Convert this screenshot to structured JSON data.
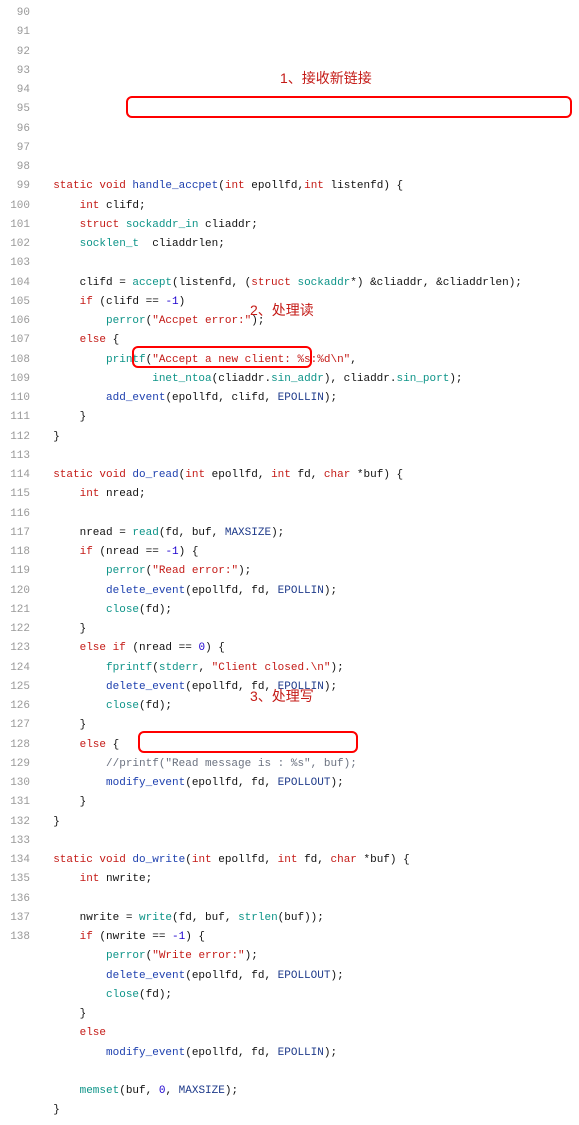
{
  "annotations": {
    "a1": "1、接收新链接",
    "a2": "2、处理读",
    "a3": "3、处理写"
  },
  "lines": [
    {
      "n": 90,
      "segs": [
        {
          "t": "  ",
          "c": "ident"
        },
        {
          "t": "static void ",
          "c": "kw-red"
        },
        {
          "t": "handle_accpet",
          "c": "fn-blue"
        },
        {
          "t": "(",
          "c": "op"
        },
        {
          "t": "int",
          "c": "kw-red"
        },
        {
          "t": " epollfd,",
          "c": "ident"
        },
        {
          "t": "int",
          "c": "kw-red"
        },
        {
          "t": " listenfd) {",
          "c": "ident"
        }
      ]
    },
    {
      "n": 91,
      "segs": [
        {
          "t": "      ",
          "c": "ident"
        },
        {
          "t": "int",
          "c": "kw-red"
        },
        {
          "t": " clifd;",
          "c": "ident"
        }
      ]
    },
    {
      "n": 92,
      "segs": [
        {
          "t": "      ",
          "c": "ident"
        },
        {
          "t": "struct",
          "c": "kw-red"
        },
        {
          "t": " ",
          "c": "ident"
        },
        {
          "t": "sockaddr_in",
          "c": "fn-teal"
        },
        {
          "t": " cliaddr;",
          "c": "ident"
        }
      ]
    },
    {
      "n": 93,
      "segs": [
        {
          "t": "      ",
          "c": "ident"
        },
        {
          "t": "socklen_t",
          "c": "fn-teal"
        },
        {
          "t": "  cliaddrlen;",
          "c": "ident"
        }
      ]
    },
    {
      "n": 94,
      "segs": [
        {
          "t": " ",
          "c": "ident"
        }
      ]
    },
    {
      "n": 95,
      "segs": [
        {
          "t": "      clifd = ",
          "c": "ident"
        },
        {
          "t": "accept",
          "c": "fn-teal"
        },
        {
          "t": "(listenfd, (",
          "c": "ident"
        },
        {
          "t": "struct",
          "c": "kw-red"
        },
        {
          "t": " ",
          "c": "ident"
        },
        {
          "t": "sockaddr",
          "c": "fn-teal"
        },
        {
          "t": "*) &cliaddr, &cliaddrlen);",
          "c": "ident"
        }
      ]
    },
    {
      "n": 96,
      "segs": [
        {
          "t": "      ",
          "c": "ident"
        },
        {
          "t": "if",
          "c": "kw-red"
        },
        {
          "t": " (clifd == ",
          "c": "ident"
        },
        {
          "t": "-1",
          "c": "num"
        },
        {
          "t": ")",
          "c": "ident"
        }
      ]
    },
    {
      "n": 97,
      "segs": [
        {
          "t": "          ",
          "c": "ident"
        },
        {
          "t": "perror",
          "c": "fn-teal"
        },
        {
          "t": "(",
          "c": "ident"
        },
        {
          "t": "\"Accpet error:\"",
          "c": "str"
        },
        {
          "t": ");",
          "c": "ident"
        }
      ]
    },
    {
      "n": 98,
      "segs": [
        {
          "t": "      ",
          "c": "ident"
        },
        {
          "t": "else",
          "c": "kw-red"
        },
        {
          "t": " {",
          "c": "ident"
        }
      ]
    },
    {
      "n": 99,
      "segs": [
        {
          "t": "          ",
          "c": "ident"
        },
        {
          "t": "printf",
          "c": "fn-teal"
        },
        {
          "t": "(",
          "c": "ident"
        },
        {
          "t": "\"Accept a new client: %s:%d\\n\"",
          "c": "str"
        },
        {
          "t": ",",
          "c": "ident"
        }
      ]
    },
    {
      "n": 100,
      "segs": [
        {
          "t": "                 ",
          "c": "ident"
        },
        {
          "t": "inet_ntoa",
          "c": "fn-teal"
        },
        {
          "t": "(cliaddr.",
          "c": "ident"
        },
        {
          "t": "sin_addr",
          "c": "fn-teal"
        },
        {
          "t": "), cliaddr.",
          "c": "ident"
        },
        {
          "t": "sin_port",
          "c": "fn-teal"
        },
        {
          "t": ");",
          "c": "ident"
        }
      ]
    },
    {
      "n": 101,
      "segs": [
        {
          "t": "          ",
          "c": "ident"
        },
        {
          "t": "add_event",
          "c": "fn-blue"
        },
        {
          "t": "(epollfd, clifd, ",
          "c": "ident"
        },
        {
          "t": "EPOLLIN",
          "c": "const-blue"
        },
        {
          "t": ");",
          "c": "ident"
        }
      ]
    },
    {
      "n": 102,
      "segs": [
        {
          "t": "      }",
          "c": "ident"
        }
      ]
    },
    {
      "n": 103,
      "segs": [
        {
          "t": "  }",
          "c": "ident"
        }
      ]
    },
    {
      "n": 104,
      "segs": [
        {
          "t": " ",
          "c": "ident"
        }
      ]
    },
    {
      "n": 105,
      "segs": [
        {
          "t": "  ",
          "c": "ident"
        },
        {
          "t": "static void ",
          "c": "kw-red"
        },
        {
          "t": "do_read",
          "c": "fn-blue"
        },
        {
          "t": "(",
          "c": "ident"
        },
        {
          "t": "int",
          "c": "kw-red"
        },
        {
          "t": " epollfd, ",
          "c": "ident"
        },
        {
          "t": "int",
          "c": "kw-red"
        },
        {
          "t": " fd, ",
          "c": "ident"
        },
        {
          "t": "char",
          "c": "kw-red"
        },
        {
          "t": " *buf) {",
          "c": "ident"
        }
      ]
    },
    {
      "n": 106,
      "segs": [
        {
          "t": "      ",
          "c": "ident"
        },
        {
          "t": "int",
          "c": "kw-red"
        },
        {
          "t": " nread;",
          "c": "ident"
        }
      ]
    },
    {
      "n": 107,
      "segs": [
        {
          "t": " ",
          "c": "ident"
        }
      ]
    },
    {
      "n": 108,
      "segs": [
        {
          "t": "      nread = ",
          "c": "ident"
        },
        {
          "t": "read",
          "c": "fn-teal"
        },
        {
          "t": "(fd, buf, ",
          "c": "ident"
        },
        {
          "t": "MAXSIZE",
          "c": "const-blue"
        },
        {
          "t": ");",
          "c": "ident"
        }
      ]
    },
    {
      "n": 109,
      "segs": [
        {
          "t": "      ",
          "c": "ident"
        },
        {
          "t": "if",
          "c": "kw-red"
        },
        {
          "t": " (nread == ",
          "c": "ident"
        },
        {
          "t": "-1",
          "c": "num"
        },
        {
          "t": ") {",
          "c": "ident"
        }
      ]
    },
    {
      "n": 110,
      "segs": [
        {
          "t": "          ",
          "c": "ident"
        },
        {
          "t": "perror",
          "c": "fn-teal"
        },
        {
          "t": "(",
          "c": "ident"
        },
        {
          "t": "\"Read error:\"",
          "c": "str"
        },
        {
          "t": ");",
          "c": "ident"
        }
      ]
    },
    {
      "n": 111,
      "segs": [
        {
          "t": "          ",
          "c": "ident"
        },
        {
          "t": "delete_event",
          "c": "fn-blue"
        },
        {
          "t": "(epollfd, fd, ",
          "c": "ident"
        },
        {
          "t": "EPOLLIN",
          "c": "const-blue"
        },
        {
          "t": ");",
          "c": "ident"
        }
      ]
    },
    {
      "n": 112,
      "segs": [
        {
          "t": "          ",
          "c": "ident"
        },
        {
          "t": "close",
          "c": "fn-teal"
        },
        {
          "t": "(fd);",
          "c": "ident"
        }
      ]
    },
    {
      "n": 113,
      "segs": [
        {
          "t": "      }",
          "c": "ident"
        }
      ]
    },
    {
      "n": 114,
      "segs": [
        {
          "t": "      ",
          "c": "ident"
        },
        {
          "t": "else if",
          "c": "kw-red"
        },
        {
          "t": " (nread == ",
          "c": "ident"
        },
        {
          "t": "0",
          "c": "num"
        },
        {
          "t": ") {",
          "c": "ident"
        }
      ]
    },
    {
      "n": 115,
      "segs": [
        {
          "t": "          ",
          "c": "ident"
        },
        {
          "t": "fprintf",
          "c": "fn-teal"
        },
        {
          "t": "(",
          "c": "ident"
        },
        {
          "t": "stderr",
          "c": "fn-teal"
        },
        {
          "t": ", ",
          "c": "ident"
        },
        {
          "t": "\"Client closed.\\n\"",
          "c": "str"
        },
        {
          "t": ");",
          "c": "ident"
        }
      ]
    },
    {
      "n": 116,
      "segs": [
        {
          "t": "          ",
          "c": "ident"
        },
        {
          "t": "delete_event",
          "c": "fn-blue"
        },
        {
          "t": "(epollfd, fd, ",
          "c": "ident"
        },
        {
          "t": "EPOLLIN",
          "c": "const-blue"
        },
        {
          "t": ");",
          "c": "ident"
        }
      ]
    },
    {
      "n": 117,
      "segs": [
        {
          "t": "          ",
          "c": "ident"
        },
        {
          "t": "close",
          "c": "fn-teal"
        },
        {
          "t": "(fd);",
          "c": "ident"
        }
      ]
    },
    {
      "n": 118,
      "segs": [
        {
          "t": "      }",
          "c": "ident"
        }
      ]
    },
    {
      "n": 119,
      "segs": [
        {
          "t": "      ",
          "c": "ident"
        },
        {
          "t": "else",
          "c": "kw-red"
        },
        {
          "t": " {",
          "c": "ident"
        }
      ]
    },
    {
      "n": 120,
      "segs": [
        {
          "t": "          ",
          "c": "ident"
        },
        {
          "t": "//printf(\"Read message is : %s\", buf);",
          "c": "comment"
        }
      ]
    },
    {
      "n": 121,
      "segs": [
        {
          "t": "          ",
          "c": "ident"
        },
        {
          "t": "modify_event",
          "c": "fn-blue"
        },
        {
          "t": "(epollfd, fd, ",
          "c": "ident"
        },
        {
          "t": "EPOLLOUT",
          "c": "const-blue"
        },
        {
          "t": ");",
          "c": "ident"
        }
      ]
    },
    {
      "n": 122,
      "segs": [
        {
          "t": "      }",
          "c": "ident"
        }
      ]
    },
    {
      "n": 123,
      "segs": [
        {
          "t": "  }",
          "c": "ident"
        }
      ]
    },
    {
      "n": 124,
      "segs": [
        {
          "t": " ",
          "c": "ident"
        }
      ]
    },
    {
      "n": 125,
      "segs": [
        {
          "t": "  ",
          "c": "ident"
        },
        {
          "t": "static void ",
          "c": "kw-red"
        },
        {
          "t": "do_write",
          "c": "fn-blue"
        },
        {
          "t": "(",
          "c": "ident"
        },
        {
          "t": "int",
          "c": "kw-red"
        },
        {
          "t": " epollfd, ",
          "c": "ident"
        },
        {
          "t": "int",
          "c": "kw-red"
        },
        {
          "t": " fd, ",
          "c": "ident"
        },
        {
          "t": "char",
          "c": "kw-red"
        },
        {
          "t": " *buf) {",
          "c": "ident"
        }
      ]
    },
    {
      "n": 126,
      "segs": [
        {
          "t": "      ",
          "c": "ident"
        },
        {
          "t": "int",
          "c": "kw-red"
        },
        {
          "t": " nwrite;",
          "c": "ident"
        }
      ]
    },
    {
      "n": 127,
      "segs": [
        {
          "t": " ",
          "c": "ident"
        }
      ]
    },
    {
      "n": 128,
      "segs": [
        {
          "t": "      nwrite = ",
          "c": "ident"
        },
        {
          "t": "write",
          "c": "fn-teal"
        },
        {
          "t": "(fd, buf, ",
          "c": "ident"
        },
        {
          "t": "strlen",
          "c": "fn-teal"
        },
        {
          "t": "(buf));",
          "c": "ident"
        }
      ]
    },
    {
      "n": 129,
      "segs": [
        {
          "t": "      ",
          "c": "ident"
        },
        {
          "t": "if",
          "c": "kw-red"
        },
        {
          "t": " (nwrite == ",
          "c": "ident"
        },
        {
          "t": "-1",
          "c": "num"
        },
        {
          "t": ") {",
          "c": "ident"
        }
      ]
    },
    {
      "n": 130,
      "segs": [
        {
          "t": "          ",
          "c": "ident"
        },
        {
          "t": "perror",
          "c": "fn-teal"
        },
        {
          "t": "(",
          "c": "ident"
        },
        {
          "t": "\"Write error:\"",
          "c": "str"
        },
        {
          "t": ");",
          "c": "ident"
        }
      ]
    },
    {
      "n": 131,
      "segs": [
        {
          "t": "          ",
          "c": "ident"
        },
        {
          "t": "delete_event",
          "c": "fn-blue"
        },
        {
          "t": "(epollfd, fd, ",
          "c": "ident"
        },
        {
          "t": "EPOLLOUT",
          "c": "const-blue"
        },
        {
          "t": ");",
          "c": "ident"
        }
      ]
    },
    {
      "n": 132,
      "segs": [
        {
          "t": "          ",
          "c": "ident"
        },
        {
          "t": "close",
          "c": "fn-teal"
        },
        {
          "t": "(fd);",
          "c": "ident"
        }
      ]
    },
    {
      "n": 133,
      "segs": [
        {
          "t": "      }",
          "c": "ident"
        }
      ]
    },
    {
      "n": 134,
      "segs": [
        {
          "t": "      ",
          "c": "ident"
        },
        {
          "t": "else",
          "c": "kw-red"
        }
      ]
    },
    {
      "n": 135,
      "segs": [
        {
          "t": "          ",
          "c": "ident"
        },
        {
          "t": "modify_event",
          "c": "fn-blue"
        },
        {
          "t": "(epollfd, fd, ",
          "c": "ident"
        },
        {
          "t": "EPOLLIN",
          "c": "const-blue"
        },
        {
          "t": ");",
          "c": "ident"
        }
      ]
    },
    {
      "n": 136,
      "segs": [
        {
          "t": " ",
          "c": "ident"
        }
      ]
    },
    {
      "n": 137,
      "segs": [
        {
          "t": "      ",
          "c": "ident"
        },
        {
          "t": "memset",
          "c": "fn-teal"
        },
        {
          "t": "(buf, ",
          "c": "ident"
        },
        {
          "t": "0",
          "c": "num"
        },
        {
          "t": ", ",
          "c": "ident"
        },
        {
          "t": "MAXSIZE",
          "c": "const-blue"
        },
        {
          "t": ");",
          "c": "ident"
        }
      ]
    },
    {
      "n": 138,
      "segs": [
        {
          "t": "  }",
          "c": "ident"
        }
      ]
    }
  ]
}
